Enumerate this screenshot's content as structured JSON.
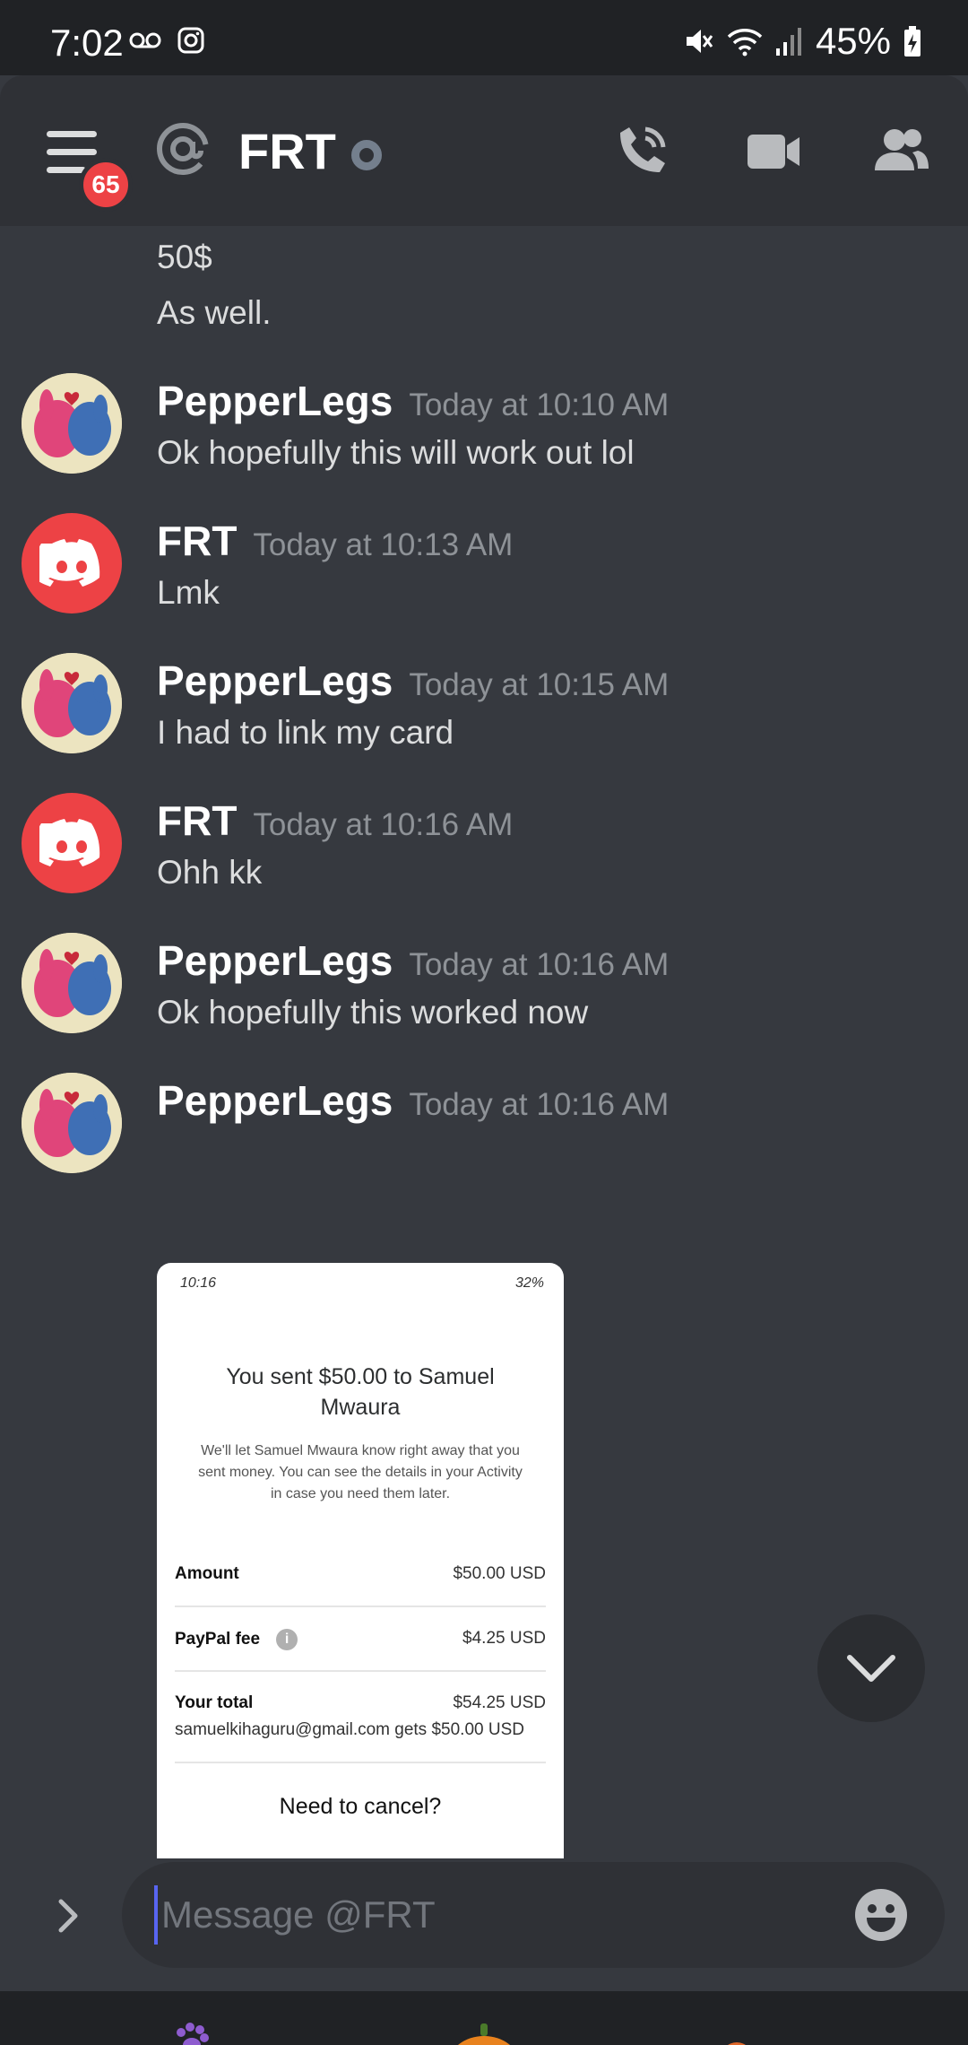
{
  "status_bar": {
    "time": "7:02",
    "battery": "45%"
  },
  "header": {
    "channel_name": "FRT",
    "unread_badge": "65"
  },
  "messages": {
    "continued": [
      "50$",
      "As well."
    ],
    "items": [
      {
        "author": "PepperLegs",
        "timestamp": "Today at 10:10 AM",
        "text": "Ok hopefully this will work out lol",
        "avatar": "pepper"
      },
      {
        "author": "FRT",
        "timestamp": "Today at 10:13 AM",
        "text": "Lmk",
        "avatar": "discord"
      },
      {
        "author": "PepperLegs",
        "timestamp": "Today at 10:15 AM",
        "text": "I had to link my card",
        "avatar": "pepper"
      },
      {
        "author": "FRT",
        "timestamp": "Today at 10:16 AM",
        "text": "Ohh kk",
        "avatar": "discord"
      },
      {
        "author": "PepperLegs",
        "timestamp": "Today at 10:16 AM",
        "text": "Ok hopefully this worked now",
        "avatar": "pepper"
      },
      {
        "author": "PepperLegs",
        "timestamp": "Today at 10:16 AM",
        "text": "",
        "avatar": "pepper"
      }
    ]
  },
  "attachment": {
    "status_time": "10:16",
    "status_battery": "32%",
    "title": "You sent $50.00 to Samuel Mwaura",
    "description": "We'll let Samuel Mwaura know right away that you sent money. You can see the details in your Activity in case you need them later.",
    "rows": [
      {
        "label": "Amount",
        "value": "$50.00 USD"
      },
      {
        "label": "PayPal fee",
        "value": "$4.25 USD"
      },
      {
        "label": "Your total",
        "value": "$54.25 USD"
      }
    ],
    "recipient_line": "samuelkihaguru@gmail.com gets $50.00 USD",
    "cancel_text": "Need to cancel?"
  },
  "composer": {
    "placeholder": "Message @FRT"
  },
  "colors": {
    "background": "#36393f",
    "header": "#2f3136",
    "accent_red": "#ed4245"
  }
}
